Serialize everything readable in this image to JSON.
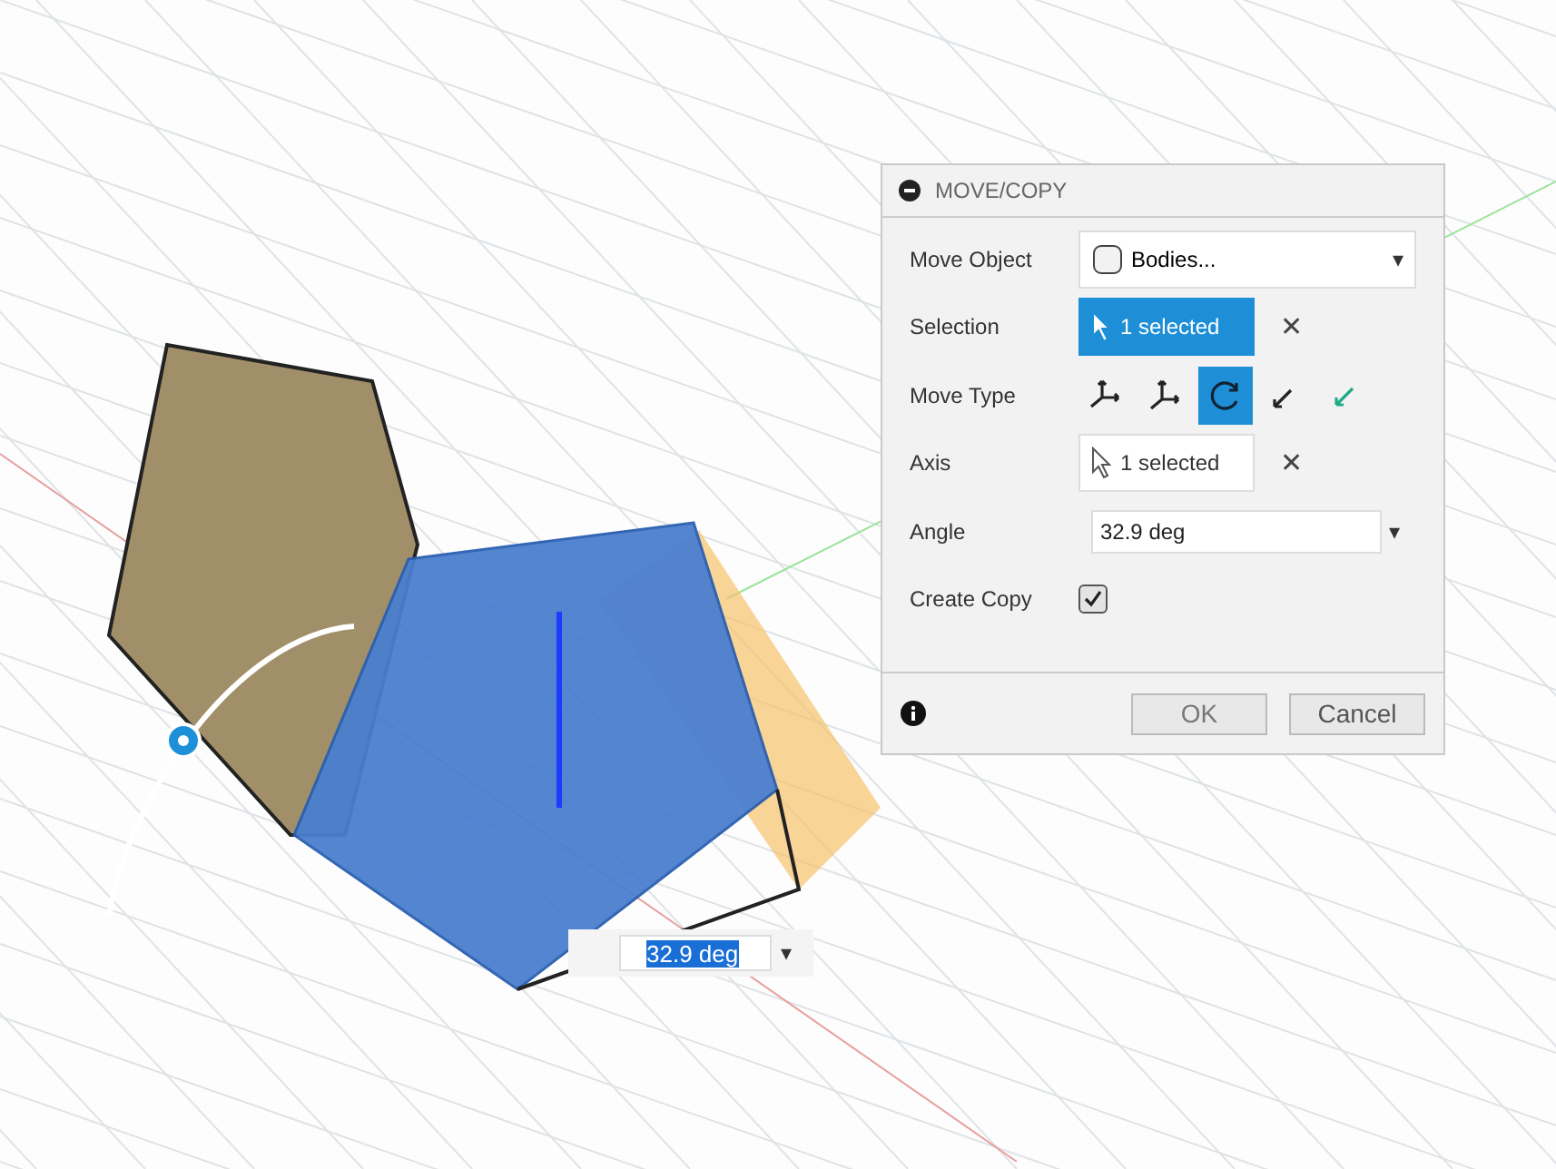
{
  "dialog": {
    "title": "MOVE/COPY",
    "rows": [
      {
        "kind": "dropdown",
        "label": "Move Object",
        "value": "Bodies...",
        "caret": "▾"
      },
      {
        "kind": "selection",
        "label": "Selection",
        "value": "1 selected",
        "selected": true,
        "clear": "✕"
      },
      {
        "kind": "types",
        "label": "Move Type",
        "options": [
          {
            "selected": false
          },
          {
            "selected": false
          },
          {
            "selected": true
          },
          {
            "selected": false
          },
          {
            "selected": false
          }
        ]
      },
      {
        "kind": "selection",
        "label": "Axis",
        "value": "1 selected",
        "selected": false,
        "clear": "✕"
      },
      {
        "kind": "input",
        "label": "Angle",
        "value": "32.9 deg",
        "caret": "▾"
      },
      {
        "kind": "checkbox",
        "label": "Create Copy",
        "checked": true
      }
    ],
    "buttons": [
      "OK",
      "Cancel"
    ]
  },
  "inline_input": {
    "value": "32.9 deg",
    "caret": "▾"
  }
}
